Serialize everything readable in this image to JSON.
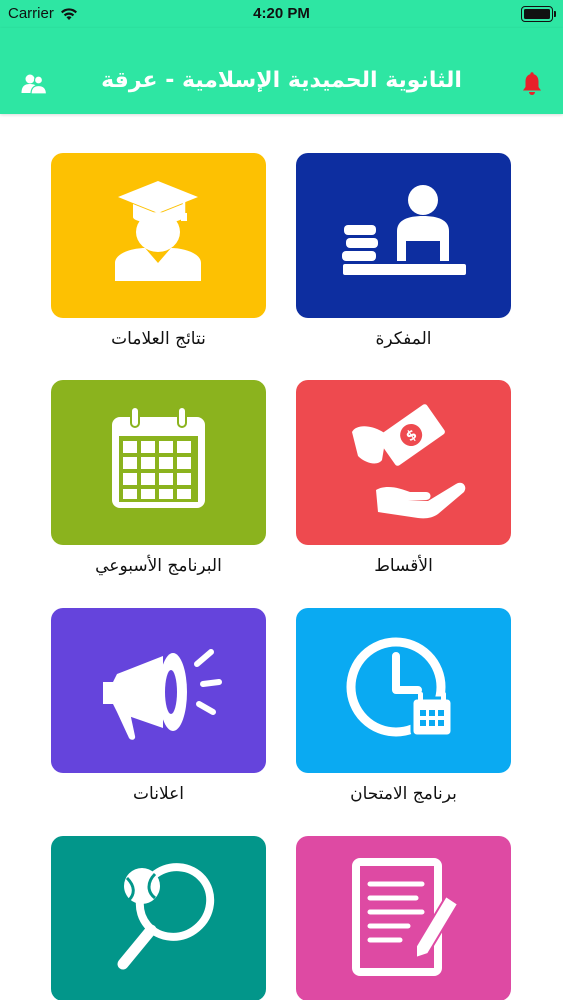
{
  "status_bar": {
    "carrier": "Carrier",
    "time": "4:20 PM"
  },
  "header": {
    "title": "الثانوية الحميدية الإسلامية - عرقة",
    "left_icon": "users-icon",
    "right_icon": "bell-icon",
    "background": "#2ee6a3",
    "bell_color": "#e8202a"
  },
  "tiles": [
    {
      "label": "المفكرة",
      "icon": "student-desk-icon",
      "color": "#0d2ea0"
    },
    {
      "label": "نتائج العلامات",
      "icon": "graduate-icon",
      "color": "#fdc102"
    },
    {
      "label": "الأقساط",
      "icon": "payment-hand-icon",
      "color": "#ee4a4f"
    },
    {
      "label": "البرنامج الأسبوعي",
      "icon": "calendar-icon",
      "color": "#8bb31e"
    },
    {
      "label": "برنامج الامتحان",
      "icon": "clock-calendar-icon",
      "color": "#0aaaf2"
    },
    {
      "label": "اعلانات",
      "icon": "megaphone-icon",
      "color": "#6544dc"
    },
    {
      "label": "",
      "icon": "document-pen-icon",
      "color": "#de4aa3"
    },
    {
      "label": "",
      "icon": "tennis-racket-icon",
      "color": "#02968a"
    }
  ]
}
